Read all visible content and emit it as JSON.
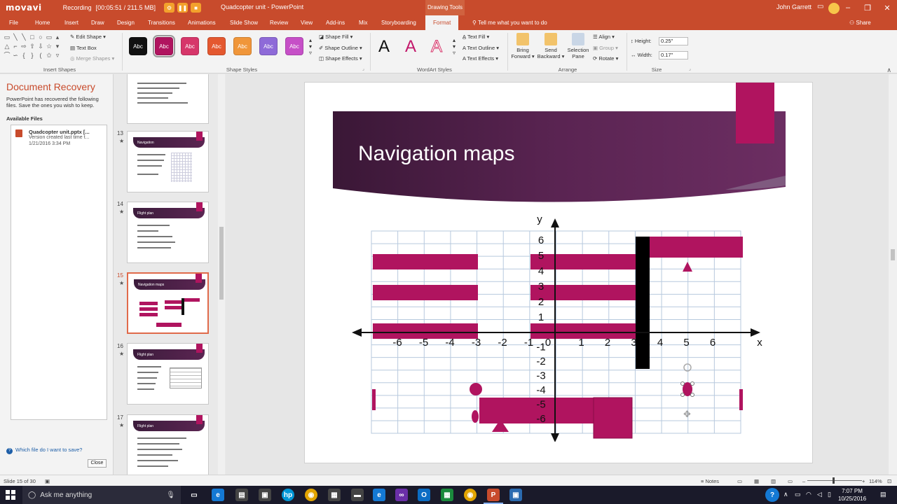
{
  "titlebar": {
    "recorder_brand": "movavi",
    "recording_label": "Recording",
    "recording_time": "[00:05:51 / 211.5 MB]",
    "doc_title": "Quadcopter unit - PowerPoint",
    "context_tab_title": "Drawing Tools",
    "user": "John Garrett"
  },
  "tabs": [
    {
      "label": "File"
    },
    {
      "label": "Home"
    },
    {
      "label": "Insert"
    },
    {
      "label": "Draw"
    },
    {
      "label": "Design"
    },
    {
      "label": "Transitions"
    },
    {
      "label": "Animations"
    },
    {
      "label": "Slide Show"
    },
    {
      "label": "Review"
    },
    {
      "label": "View"
    },
    {
      "label": "Add-ins"
    },
    {
      "label": "Mix"
    },
    {
      "label": "Storyboarding"
    },
    {
      "label": "Format"
    }
  ],
  "tellme": "Tell me what you want to do",
  "share": "Share",
  "ribbon": {
    "insert_shapes": {
      "label": "Insert Shapes",
      "edit_shape": "Edit Shape",
      "text_box": "Text Box",
      "merge_shapes": "Merge Shapes"
    },
    "shape_styles": {
      "label": "Shape Styles",
      "swatch_text": "Abc",
      "swatches": [
        "#111111",
        "#b0145f",
        "#d6366a",
        "#e4582f",
        "#f0963a",
        "#8e6ad8",
        "#c64fc7"
      ],
      "shape_fill": "Shape Fill",
      "shape_outline": "Shape Outline",
      "shape_effects": "Shape Effects"
    },
    "wordart_styles": {
      "label": "WordArt Styles",
      "glyph": "A",
      "text_fill": "Text Fill",
      "text_outline": "Text Outline",
      "text_effects": "Text Effects"
    },
    "arrange": {
      "label": "Arrange",
      "bring_forward": [
        "Bring",
        "Forward"
      ],
      "send_backward": [
        "Send",
        "Backward"
      ],
      "selection_pane": [
        "Selection",
        "Pane"
      ],
      "align": "Align",
      "group": "Group",
      "rotate": "Rotate"
    },
    "size": {
      "label": "Size",
      "height_label": "Height:",
      "height_value": "0.25\"",
      "width_label": "Width:",
      "width_value": "0.17\""
    }
  },
  "recovery": {
    "title": "Document Recovery",
    "description": "PowerPoint has recovered the following files.  Save the ones you wish to keep.",
    "available_files": "Available Files",
    "files": [
      {
        "name": "Quadcopter unit.pptx  [...",
        "line1": "Version created last time t...",
        "line2": "1/21/2016 3:34 PM"
      }
    ],
    "help_link": "Which file do I want to save?",
    "close": "Close"
  },
  "thumbnails": [
    {
      "number": "13",
      "title": "Navigation"
    },
    {
      "number": "14",
      "title": "Flight plan"
    },
    {
      "number": "15",
      "title": "Navigation maps"
    },
    {
      "number": "16",
      "title": "Flight plan"
    },
    {
      "number": "17",
      "title": "Flight plan"
    }
  ],
  "slide": {
    "title": "Navigation maps",
    "accent_color": "#b0145f",
    "graph": {
      "y_label": "y",
      "x_label": "x",
      "x_ticks": [
        "-6",
        "-5",
        "-4",
        "-3",
        "-2",
        "-1",
        "0",
        "1",
        "2",
        "3",
        "4",
        "5",
        "6"
      ],
      "y_ticks_pos": [
        "6",
        "5",
        "4",
        "3",
        "2",
        "1"
      ],
      "y_ticks_neg": [
        "-1",
        "-2",
        "-3",
        "-4",
        "-5",
        "-6"
      ]
    }
  },
  "status": {
    "slide_info": "Slide 15 of 30",
    "notes": "Notes",
    "zoom": "114%"
  },
  "taskbar": {
    "search_placeholder": "Ask me anything",
    "time": "7:07 PM",
    "date": "10/25/2016"
  }
}
